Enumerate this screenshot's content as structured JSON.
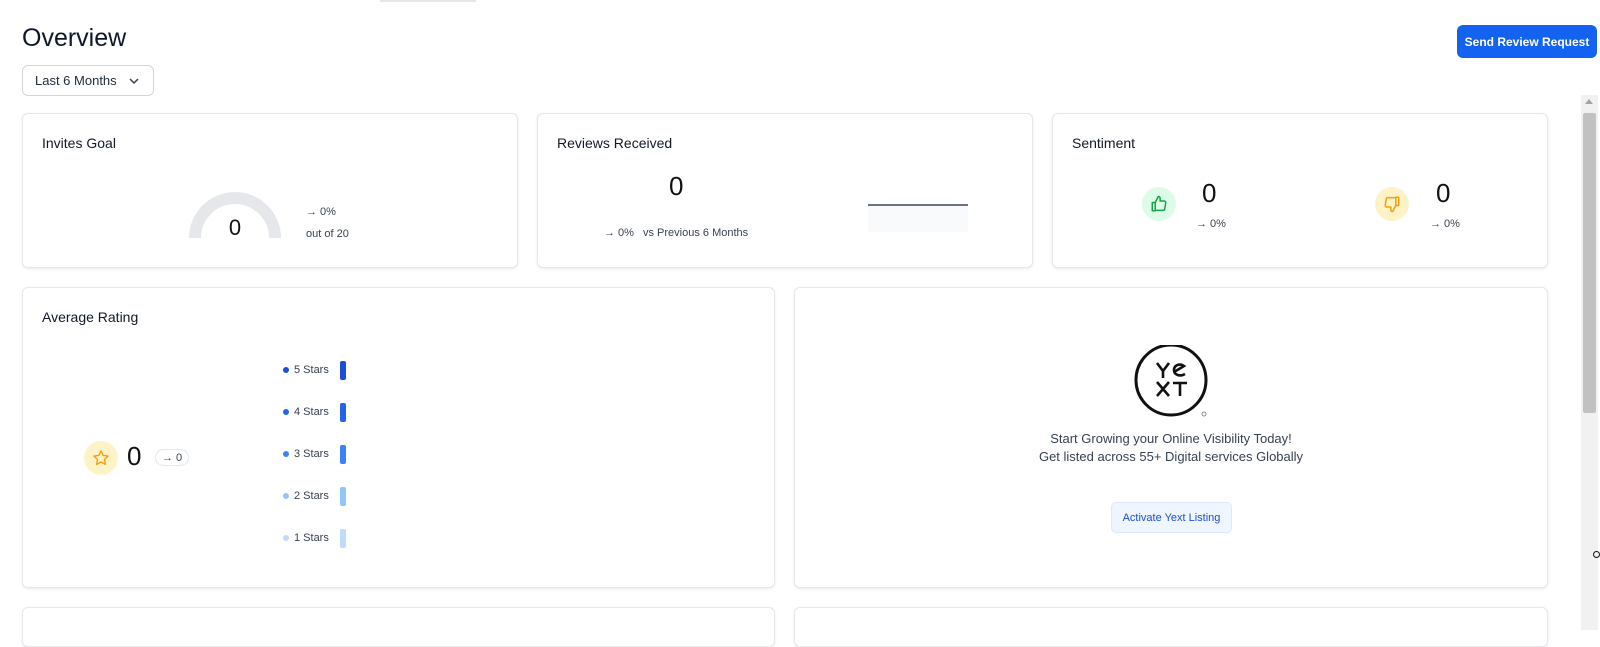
{
  "header": {
    "title": "Overview",
    "period_label": "Last 6 Months",
    "send_review_button": "Send Review Request"
  },
  "invites_goal": {
    "title": "Invites Goal",
    "value": "0",
    "change": "→ 0%",
    "out_of": "out of 20",
    "progress_fraction": 0
  },
  "reviews_received": {
    "title": "Reviews Received",
    "value": "0",
    "change": "→ 0%",
    "comparison": "vs Previous 6 Months"
  },
  "sentiment": {
    "title": "Sentiment",
    "positive": {
      "value": "0",
      "change": "→ 0%",
      "icon": "thumbs-up-icon",
      "color": "#16a34a"
    },
    "negative": {
      "value": "0",
      "change": "→ 0%",
      "icon": "thumbs-down-icon",
      "color": "#f59e0b"
    }
  },
  "average_rating": {
    "title": "Average Rating",
    "value": "0",
    "change": "→ 0",
    "icon": "star-icon",
    "rows": [
      {
        "label": "5 Stars",
        "color": "#1d4ed8"
      },
      {
        "label": "4 Stars",
        "color": "#2563eb"
      },
      {
        "label": "3 Stars",
        "color": "#3b82f6"
      },
      {
        "label": "2 Stars",
        "color": "#93c5fd"
      },
      {
        "label": "1 Stars",
        "color": "#bfdbfe"
      }
    ]
  },
  "yext": {
    "line1": "Start Growing your Online Visibility Today!",
    "line2": "Get listed across 55+ Digital services Globally",
    "button": "Activate Yext Listing"
  },
  "colors": {
    "primary": "#1462f0"
  }
}
